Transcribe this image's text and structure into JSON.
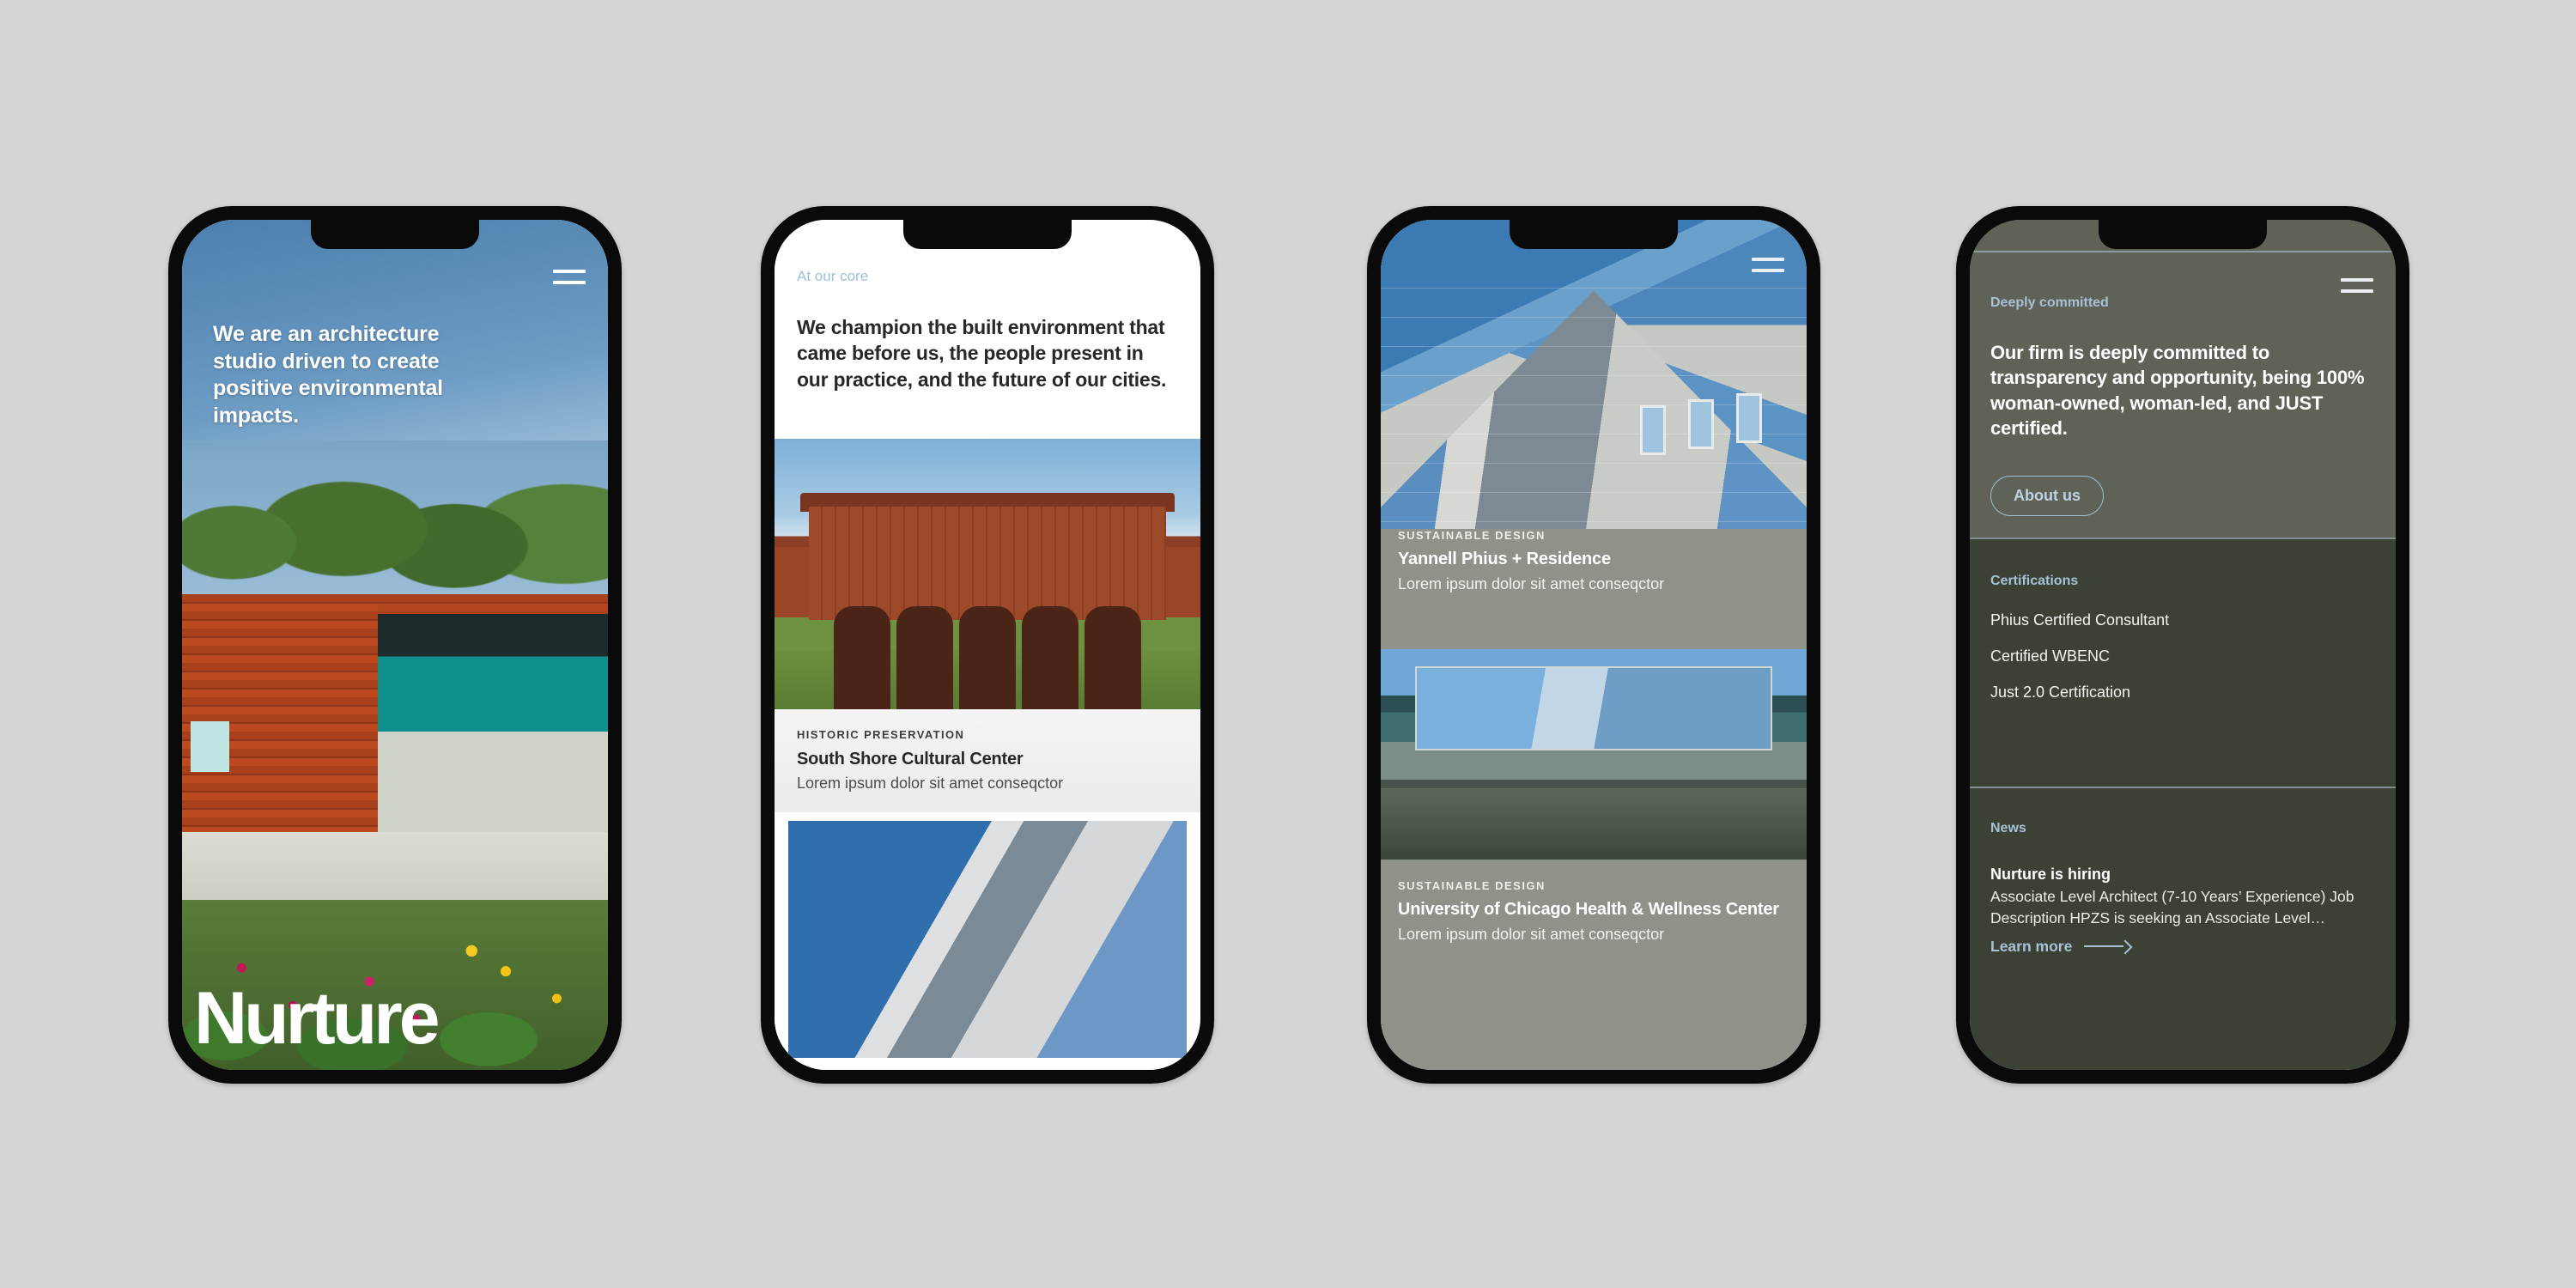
{
  "canvas": {
    "background": "#d5d5d5"
  },
  "brand": {
    "name": "Nurture",
    "accent": "#a7c1d6",
    "dark": "#3c4135"
  },
  "phones": {
    "hero": {
      "menu_icon": "hamburger-icon",
      "headline": "We are an architecture studio driven to create positive environmental impacts.",
      "logo": "Nurture"
    },
    "core": {
      "eyebrow": "At our core",
      "statement": "We champion the built environment that came before us, the people present in our practice, and the future of our cities.",
      "project": {
        "tag": "HISTORIC PRESERVATION",
        "title": "South Shore Cultural Center",
        "subtitle": "Lorem ipsum dolor sit amet conseqctor"
      }
    },
    "projects": {
      "menu_icon": "hamburger-icon",
      "items": [
        {
          "tag": "SUSTAINABLE DESIGN",
          "title": "Yannell Phius + Residence",
          "subtitle": "Lorem ipsum dolor sit amet conseqctor"
        },
        {
          "tag": "SUSTAINABLE DESIGN",
          "title": "University of Chicago Health & Wellness Center",
          "subtitle": "Lorem ipsum dolor sit amet conseqctor"
        }
      ]
    },
    "committed": {
      "menu_icon": "hamburger-icon",
      "eyebrow": "Deeply committed",
      "statement": "Our firm is deeply committed to transparency and opportunity, being 100% woman-owned, woman-led, and JUST certified.",
      "cta_label": "About us",
      "certifications": {
        "heading": "Certifications",
        "items": [
          "Phius Certified Consultant",
          "Certified WBENC",
          "Just 2.0 Certification"
        ]
      },
      "news": {
        "heading": "News",
        "title": "Nurture is hiring",
        "body": "Associate Level Architect (7-10 Years’ Experience) Job Description HPZS is seeking an Associate Level…",
        "link_label": "Learn more",
        "link_icon": "arrow-right-icon"
      }
    }
  }
}
